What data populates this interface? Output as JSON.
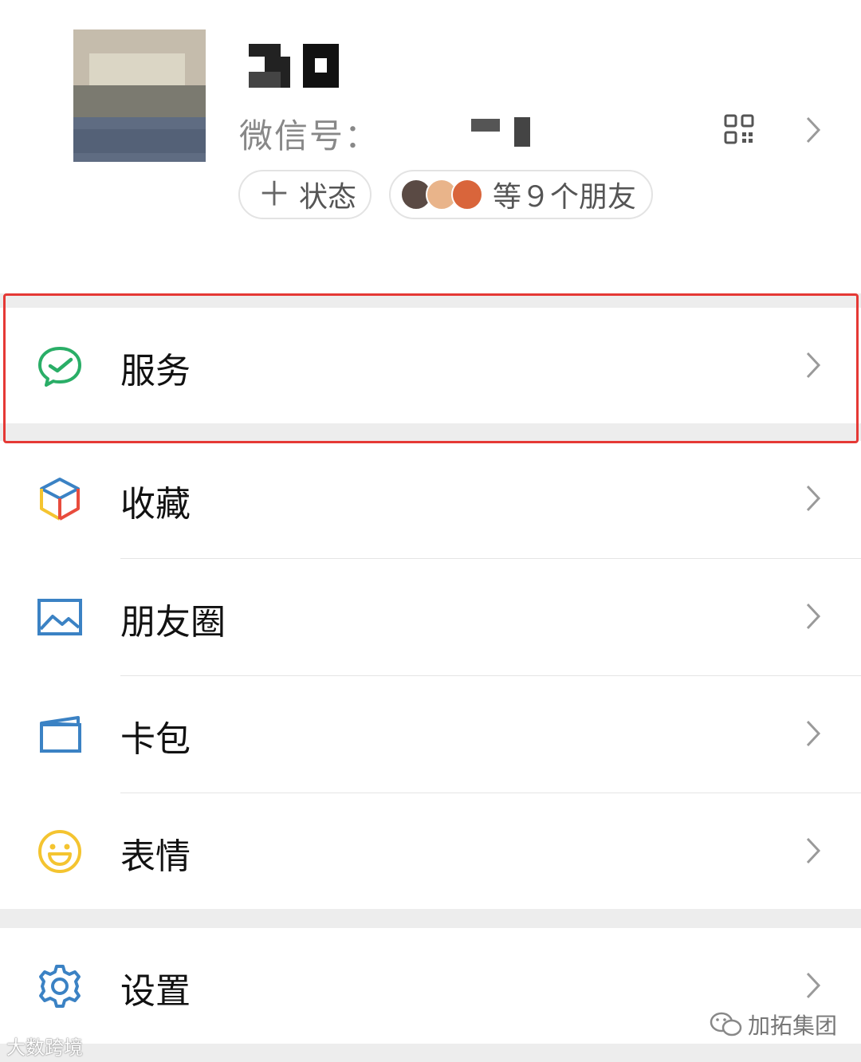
{
  "profile": {
    "wechat_id_label": "微信号：",
    "status_button": {
      "plus": "＋",
      "label": "状态"
    },
    "friends_pill": {
      "label": "等９个朋友"
    }
  },
  "menu": {
    "services": {
      "label": "服务",
      "icon": "wechat-pay-check-icon",
      "color": "#2aae67"
    },
    "favorites": {
      "label": "收藏",
      "icon": "cube-icon"
    },
    "moments": {
      "label": "朋友圈",
      "icon": "image-icon",
      "color": "#3b82c4"
    },
    "cards": {
      "label": "卡包",
      "icon": "wallet-icon",
      "color": "#3b82c4"
    },
    "stickers": {
      "label": "表情",
      "icon": "smiley-icon",
      "color": "#f4c430"
    },
    "settings": {
      "label": "设置",
      "icon": "gear-icon",
      "color": "#3b82c4"
    }
  },
  "watermarks": {
    "left": "大数跨境",
    "right": "加拓集团"
  },
  "colors": {
    "highlight_border": "#e53935",
    "section_gap": "#ededed"
  }
}
